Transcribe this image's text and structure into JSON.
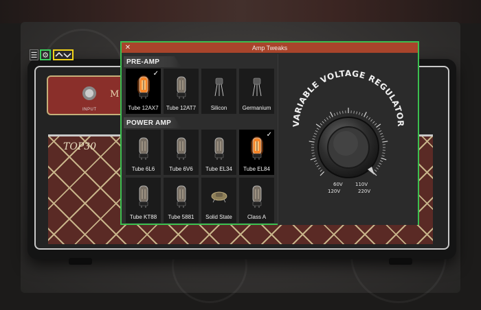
{
  "window": {
    "title": "Amp Tweaks",
    "close_glyph": "✕"
  },
  "toolbar": {
    "menu_glyph": "☰",
    "gear_glyph": "⚙",
    "preset_glyph": "︿﹀"
  },
  "amp": {
    "brand": "TOP30",
    "panel_text": "M",
    "input_label": "INPUT"
  },
  "preamp": {
    "heading": "PRE-AMP",
    "items": [
      {
        "label": "Tube 12AX7",
        "icon": "glowing-tube-icon",
        "selected": true
      },
      {
        "label": "Tube 12AT7",
        "icon": "tube-icon",
        "selected": false
      },
      {
        "label": "Silicon",
        "icon": "transistor-icon",
        "selected": false
      },
      {
        "label": "Germanium",
        "icon": "transistor-icon",
        "selected": false
      }
    ]
  },
  "poweramp": {
    "heading": "POWER AMP",
    "items": [
      {
        "label": "Tube 6L6",
        "icon": "tube-icon",
        "selected": false
      },
      {
        "label": "Tube 6V6",
        "icon": "tube-icon",
        "selected": false
      },
      {
        "label": "Tube EL34",
        "icon": "tube-icon",
        "selected": false
      },
      {
        "label": "Tube EL84",
        "icon": "glowing-tube-icon",
        "selected": true
      },
      {
        "label": "Tube KT88",
        "icon": "tube-icon",
        "selected": false
      },
      {
        "label": "Tube 5881",
        "icon": "tube-icon",
        "selected": false
      },
      {
        "label": "Solid State",
        "icon": "solid-state-icon",
        "selected": false
      },
      {
        "label": "Class A",
        "icon": "tube-icon",
        "selected": false
      }
    ]
  },
  "regulator": {
    "title": "VARIABLE VOLTAGE REGULATOR",
    "labels": {
      "v60": "60V",
      "v110": "110V",
      "v120": "120V",
      "v220": "220V"
    }
  },
  "colors": {
    "dialog_border": "#3bbf4f",
    "titlebar": "#a9442b",
    "gear_highlight": "#3ccf5c",
    "preset_highlight": "#f1d218",
    "tube_glow": "#ff7a1a"
  }
}
